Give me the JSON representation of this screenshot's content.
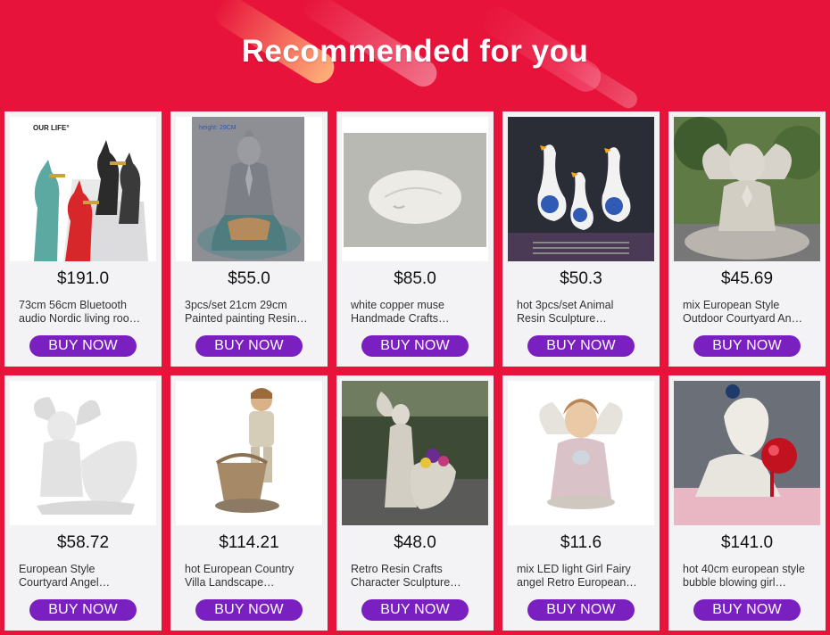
{
  "header": {
    "title": "Recommended for you"
  },
  "colors": {
    "background": "#e8133a",
    "button": "#7a1fc0",
    "card": "#f3f3f5"
  },
  "products": [
    {
      "price": "$191.0",
      "name_line1": "73cm 56cm Bluetooth",
      "name_line2": "audio Nordic living roo…",
      "button": "BUY NOW",
      "image_text": "OUR LIFE°",
      "icon": "dog-sculpture-icon"
    },
    {
      "price": "$55.0",
      "name_line1": "3pcs/set 21cm 29cm",
      "name_line2": "Painted painting Resin…",
      "button": "BUY NOW",
      "image_text": "height: 29CM",
      "icon": "buddha-statue-icon"
    },
    {
      "price": "$85.0",
      "name_line1": "white copper muse",
      "name_line2": "Handmade Crafts…",
      "button": "BUY NOW",
      "image_text": "",
      "icon": "muse-head-icon"
    },
    {
      "price": "$50.3",
      "name_line1": "hot 3pcs/set Animal",
      "name_line2": "Resin Sculpture…",
      "button": "BUY NOW",
      "image_text": "",
      "icon": "duck-figurines-icon"
    },
    {
      "price": "$45.69",
      "name_line1": "mix European Style",
      "name_line2": "Outdoor Courtyard An…",
      "button": "BUY NOW",
      "image_text": "",
      "icon": "angel-statue-icon"
    },
    {
      "price": "$58.72",
      "name_line1": "European Style",
      "name_line2": "Courtyard Angel…",
      "button": "BUY NOW",
      "image_text": "",
      "icon": "angel-planter-icon"
    },
    {
      "price": "$114.21",
      "name_line1": "hot European Country",
      "name_line2": "Villa Landscape…",
      "button": "BUY NOW",
      "image_text": "",
      "icon": "boy-basket-icon"
    },
    {
      "price": "$48.0",
      "name_line1": "Retro Resin Crafts",
      "name_line2": "Character Sculpture…",
      "button": "BUY NOW",
      "image_text": "",
      "icon": "angel-flower-planter-icon"
    },
    {
      "price": "$11.6",
      "name_line1": "mix LED light Girl Fairy",
      "name_line2": "angel Retro European…",
      "button": "BUY NOW",
      "image_text": "",
      "icon": "fairy-angel-icon"
    },
    {
      "price": "$141.0",
      "name_line1": "hot 40cm european style",
      "name_line2": "bubble blowing girl…",
      "button": "BUY NOW",
      "image_text": "",
      "icon": "bubble-girl-bust-icon"
    }
  ]
}
